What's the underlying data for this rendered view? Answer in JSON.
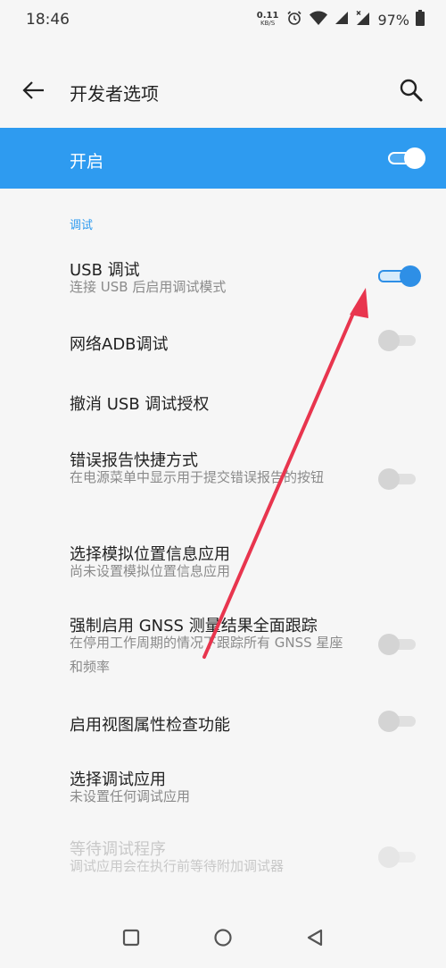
{
  "status_bar": {
    "time": "18:46",
    "net_speed_value": "0.11",
    "net_speed_unit": "KB/S",
    "battery_percent": "97%",
    "icons": [
      "alarm-icon",
      "wifi-icon",
      "signal-icon",
      "signal-x-icon",
      "battery-icon"
    ]
  },
  "app_bar": {
    "title": "开发者选项",
    "back_icon": "arrow-left-icon",
    "search_icon": "search-icon"
  },
  "master_switch": {
    "label": "开启",
    "state": "on"
  },
  "section": {
    "header": "调试"
  },
  "settings": [
    {
      "title": "USB 调试",
      "summary": "连接 USB 后启用调试模式",
      "toggle": "on"
    },
    {
      "title": "网络ADB调试",
      "summary": "",
      "toggle": "off"
    },
    {
      "title": "撤消 USB 调试授权",
      "summary": "",
      "toggle": "none"
    },
    {
      "title": "错误报告快捷方式",
      "summary": "在电源菜单中显示用于提交错误报告的按钮",
      "toggle": "off"
    },
    {
      "title": "选择模拟位置信息应用",
      "summary": "尚未设置模拟位置信息应用",
      "toggle": "none"
    },
    {
      "title": "强制启用 GNSS 测量结果全面跟踪",
      "summary": "在停用工作周期的情况下跟踪所有 GNSS 星座和频率",
      "toggle": "off"
    },
    {
      "title": "启用视图属性检查功能",
      "summary": "",
      "toggle": "off"
    },
    {
      "title": "选择调试应用",
      "summary": "未设置任何调试应用",
      "toggle": "none"
    },
    {
      "title": "等待调试程序",
      "summary": "调试应用会在执行前等待附加调试器",
      "toggle": "disabled"
    }
  ],
  "colors": {
    "accent": "#2e9bf0",
    "toggle_on": "#2e8fe6",
    "annotation_arrow": "#e8354e"
  },
  "nav_bar": {
    "icons": [
      "square-icon",
      "circle-icon",
      "triangle-back-icon"
    ]
  }
}
